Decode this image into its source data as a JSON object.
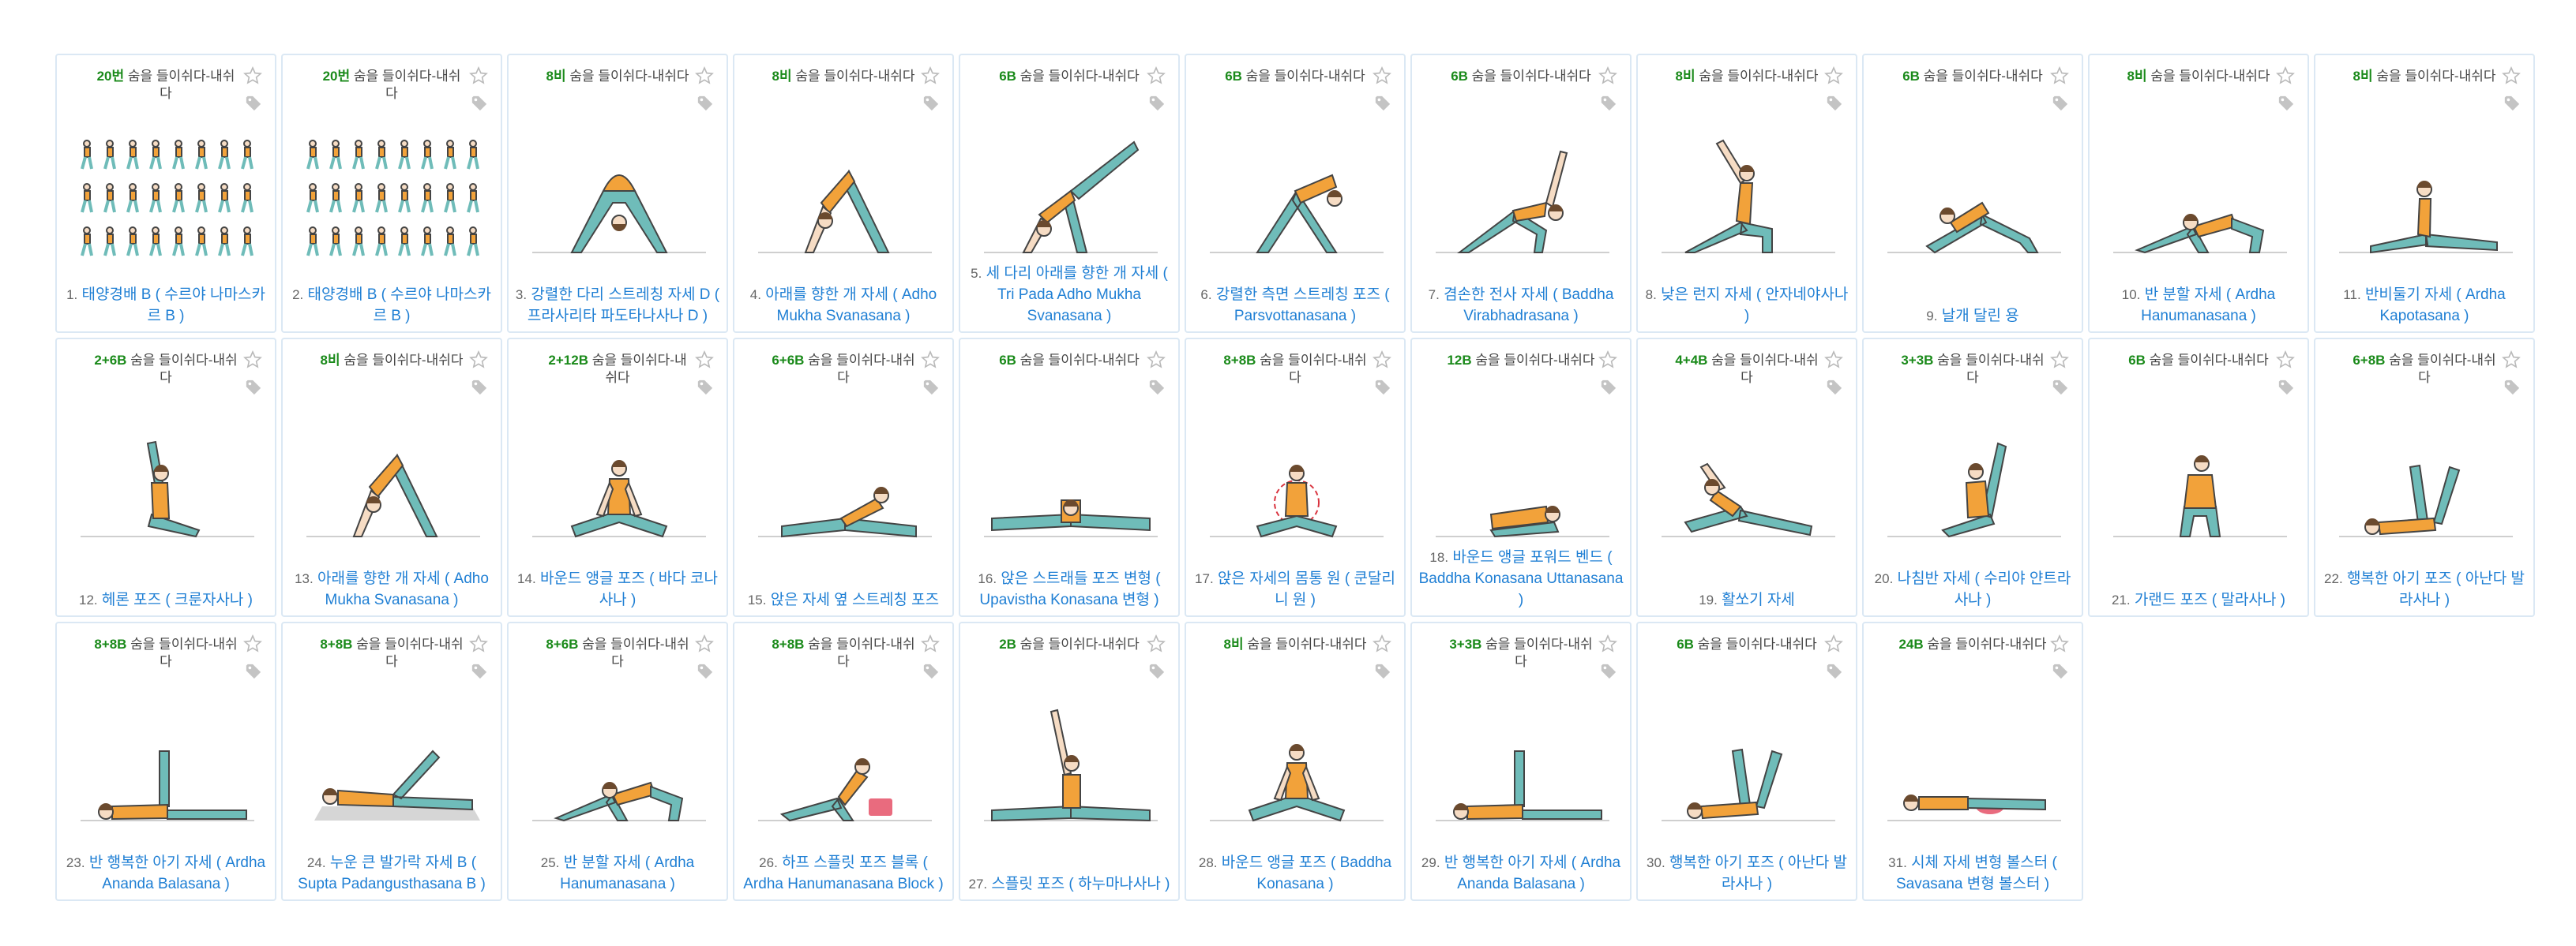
{
  "icons": {
    "favorite": "star-outline-icon",
    "tag": "tag-icon"
  },
  "colors": {
    "link": "#1f7fd4",
    "count": "#1a8a1a",
    "card_border": "#dbe8f4"
  },
  "cards": [
    {
      "count": "20번",
      "meta": "숨을 들이쉬다-내쉬다",
      "num": "1.",
      "title": "태양경배 B ( 수르야 나마스카르 B )",
      "pose": "sequence"
    },
    {
      "count": "20번",
      "meta": "숨을 들이쉬다-내쉬다",
      "num": "2.",
      "title": "태양경배 B ( 수르야 나마스카르 B )",
      "pose": "sequence"
    },
    {
      "count": "8비",
      "meta": "숨을 들이쉬다-내쉬다",
      "num": "3.",
      "title": "강렬한 다리 스트레칭 자세 D ( 프라사리타 파도타나사나 D )",
      "pose": "wide"
    },
    {
      "count": "8비",
      "meta": "숨을 들이쉬다-내쉬다",
      "num": "4.",
      "title": "아래를 향한 개 자세 ( Adho Mukha Svanasana )",
      "pose": "dog"
    },
    {
      "count": "6B",
      "meta": "숨을 들이쉬다-내쉬다",
      "num": "5.",
      "title": "세 다리 아래를 향한 개 자세 ( Tri Pada Adho Mukha Svanasana )",
      "pose": "dog3"
    },
    {
      "count": "6B",
      "meta": "숨을 들이쉬다-내쉬다",
      "num": "6.",
      "title": "강렬한 측면 스트레칭 포즈 ( Parsvottanasana )",
      "pose": "fold"
    },
    {
      "count": "6B",
      "meta": "숨을 들이쉬다-내쉬다",
      "num": "7.",
      "title": "겸손한 전사 자세 ( Baddha Virabhadrasana )",
      "pose": "warrior"
    },
    {
      "count": "8비",
      "meta": "숨을 들이쉬다-내쉬다",
      "num": "8.",
      "title": "낮은 런지 자세 ( 안자네야사나 )",
      "pose": "lunge"
    },
    {
      "count": "6B",
      "meta": "숨을 들이쉬다-내쉬다",
      "num": "9.",
      "title": "날개 달린 용",
      "pose": "dragon"
    },
    {
      "count": "8비",
      "meta": "숨을 들이쉬다-내쉬다",
      "num": "10.",
      "title": "반 분할 자세 ( Ardha Hanumanasana )",
      "pose": "halfsplit"
    },
    {
      "count": "8비",
      "meta": "숨을 들이쉬다-내쉬다",
      "num": "11.",
      "title": "반비둘기 자세 ( Ardha Kapotasana )",
      "pose": "pigeon"
    },
    {
      "count": "2+6B",
      "meta": "숨을 들이쉬다-내쉬다",
      "num": "12.",
      "title": "헤론 포즈 ( 크룬자사나 )",
      "pose": "heron"
    },
    {
      "count": "8비",
      "meta": "숨을 들이쉬다-내쉬다",
      "num": "13.",
      "title": "아래를 향한 개 자세 ( Adho Mukha Svanasana )",
      "pose": "dog"
    },
    {
      "count": "2+12B",
      "meta": "숨을 들이쉬다-내쉬다",
      "num": "14.",
      "title": "바운드 앵글 포즈 ( 바다 코나사나 )",
      "pose": "seated"
    },
    {
      "count": "6+6B",
      "meta": "숨을 들이쉬다-내쉬다",
      "num": "15.",
      "title": "앉은 자세 옆 스트레칭 포즈",
      "pose": "sidestretch"
    },
    {
      "count": "6B",
      "meta": "숨을 들이쉬다-내쉬다",
      "num": "16.",
      "title": "앉은 스트래들 포즈 변형 ( Upavistha Konasana 변형 )",
      "pose": "straddle"
    },
    {
      "count": "8+8B",
      "meta": "숨을 들이쉬다-내쉬다",
      "num": "17.",
      "title": "앉은 자세의 몸통 원 ( 쿤달리니 원 )",
      "pose": "circle"
    },
    {
      "count": "12B",
      "meta": "숨을 들이쉬다-내쉬다",
      "num": "18.",
      "title": "바운드 앵글 포워드 벤드 ( Baddha Konasana Uttanasana )",
      "pose": "forward"
    },
    {
      "count": "4+4B",
      "meta": "숨을 들이쉬다-내쉬다",
      "num": "19.",
      "title": "활쏘기 자세",
      "pose": "archer"
    },
    {
      "count": "3+3B",
      "meta": "숨을 들이쉬다-내쉬다",
      "num": "20.",
      "title": "나침반 자세 ( 수리야 얀트라사나 )",
      "pose": "compass"
    },
    {
      "count": "6B",
      "meta": "숨을 들이쉬다-내쉬다",
      "num": "21.",
      "title": "가랜드 포즈 ( 말라사나 )",
      "pose": "squat"
    },
    {
      "count": "6+8B",
      "meta": "숨을 들이쉬다-내쉬다",
      "num": "22.",
      "title": "행복한 아기 포즈 ( 아난다 발라사나 )",
      "pose": "baby"
    },
    {
      "count": "8+8B",
      "meta": "숨을 들이쉬다-내쉬다",
      "num": "23.",
      "title": "반 행복한 아기 자세 ( Ardha Ananda Balasana )",
      "pose": "halfbaby"
    },
    {
      "count": "8+8B",
      "meta": "숨을 들이쉬다-내쉬다",
      "num": "24.",
      "title": "누운 큰 발가락 자세 B ( Supta Padangusthasana B )",
      "pose": "supine"
    },
    {
      "count": "8+6B",
      "meta": "숨을 들이쉬다-내쉬다",
      "num": "25.",
      "title": "반 분할 자세 ( Ardha Hanumanasana )",
      "pose": "halfsplit"
    },
    {
      "count": "8+8B",
      "meta": "숨을 들이쉬다-내쉬다",
      "num": "26.",
      "title": "하프 스플릿 포즈 블록 ( Ardha Hanumanasana Block )",
      "pose": "block"
    },
    {
      "count": "2B",
      "meta": "숨을 들이쉬다-내쉬다",
      "num": "27.",
      "title": "스플릿 포즈 ( 하누마나사나 )",
      "pose": "split"
    },
    {
      "count": "8비",
      "meta": "숨을 들이쉬다-내쉬다",
      "num": "28.",
      "title": "바운드 앵글 포즈 ( Baddha Konasana )",
      "pose": "seated"
    },
    {
      "count": "3+3B",
      "meta": "숨을 들이쉬다-내쉬다",
      "num": "29.",
      "title": "반 행복한 아기 자세 ( Ardha Ananda Balasana )",
      "pose": "halfbaby"
    },
    {
      "count": "6B",
      "meta": "숨을 들이쉬다-내쉬다",
      "num": "30.",
      "title": "행복한 아기 포즈 ( 아난다 발라사나 )",
      "pose": "baby"
    },
    {
      "count": "24B",
      "meta": "숨을 들이쉬다-내쉬다",
      "num": "31.",
      "title": "시체 자세 변형 볼스터 ( Savasana 변형 볼스터 )",
      "pose": "savasana"
    }
  ]
}
